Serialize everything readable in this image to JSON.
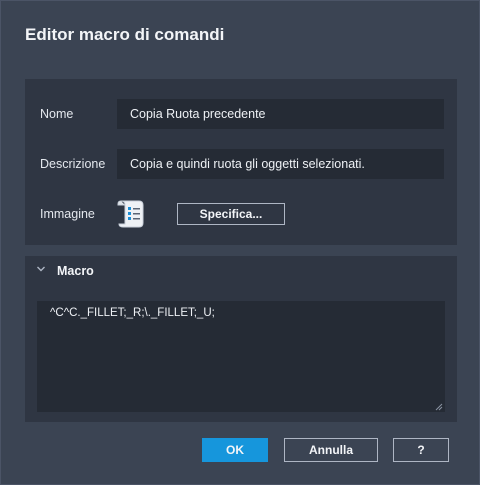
{
  "dialog": {
    "title": "Editor macro di comandi"
  },
  "properties": {
    "name_label": "Nome",
    "name_value": "Copia Ruota precedente",
    "description_label": "Descrizione",
    "description_value": "Copia e quindi ruota gli oggetti selezionati.",
    "image_label": "Immagine",
    "image_icon": "command-list-icon",
    "specify_button": "Specifica..."
  },
  "macro": {
    "section_label": "Macro",
    "expanded": true,
    "value": "^C^C._FILLET;_R;\\._FILLET;_U;"
  },
  "buttons": {
    "ok": "OK",
    "cancel": "Annulla",
    "help": "?"
  },
  "colors": {
    "background": "#3b4453",
    "panel": "#2f3643",
    "field": "#252b35",
    "accent": "#1696dc"
  }
}
